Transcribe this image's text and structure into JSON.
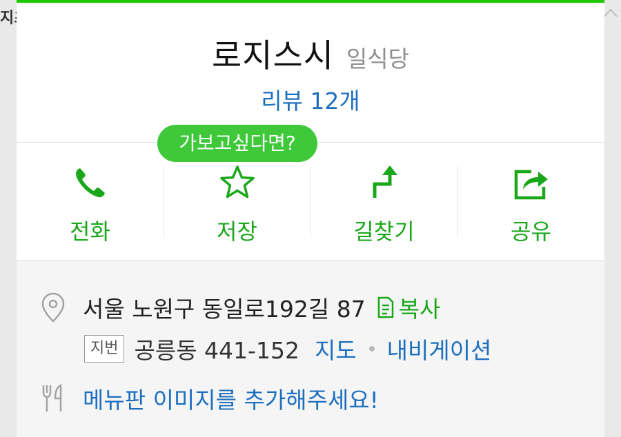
{
  "background": {
    "fragment": "지츠"
  },
  "header": {
    "place_name": "로지스시",
    "category": "일식당",
    "review_link": "리뷰 12개"
  },
  "tooltip": {
    "text": "가보고싶다면?"
  },
  "actions": [
    {
      "label": "전화",
      "icon": "phone-icon"
    },
    {
      "label": "저장",
      "icon": "star-icon"
    },
    {
      "label": "길찾기",
      "icon": "directions-icon"
    },
    {
      "label": "공유",
      "icon": "share-icon"
    }
  ],
  "info": {
    "address": "서울 노원구 동일로192길 87",
    "copy_label": "복사",
    "lot_badge": "지번",
    "lot_address": "공릉동 441-152",
    "map_link": "지도",
    "navigation_link": "내비게이션",
    "menu_prompt": "메뉴판 이미지를 추가해주세요!"
  },
  "colors": {
    "accent_green": "#1ec800",
    "action_green": "#1aa81a",
    "link_blue": "#1d6fbf",
    "tooltip_green": "#3ec83a"
  }
}
